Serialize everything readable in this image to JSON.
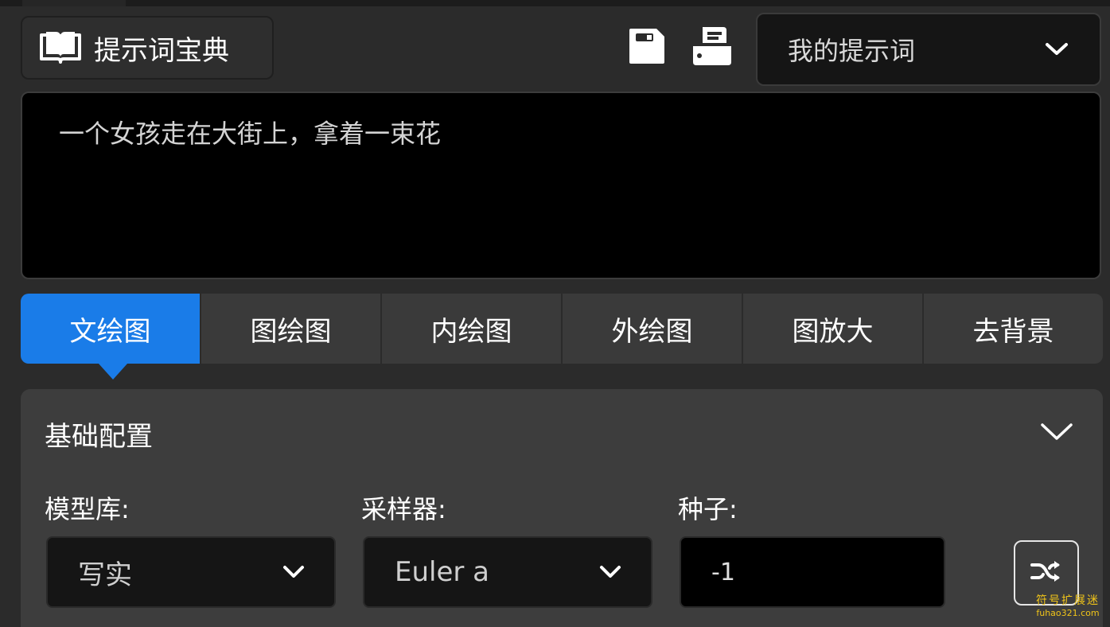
{
  "header": {
    "dict_button_label": "提示词宝典",
    "icons": {
      "dict": "book-icon",
      "save": "floppy-save-icon",
      "load": "load-prompt-icon"
    },
    "prompt_select": {
      "value": "我的提示词",
      "icon": "chevron-down-icon"
    }
  },
  "prompt": {
    "text": "一个女孩走在大街上，拿着一束花"
  },
  "tabs": [
    {
      "label": "文绘图",
      "active": true
    },
    {
      "label": "图绘图",
      "active": false
    },
    {
      "label": "内绘图",
      "active": false
    },
    {
      "label": "外绘图",
      "active": false
    },
    {
      "label": "图放大",
      "active": false
    },
    {
      "label": "去背景",
      "active": false
    }
  ],
  "config": {
    "title": "基础配置",
    "toggle_icon": "chevron-down-icon",
    "model": {
      "label": "模型库:",
      "value": "写实"
    },
    "sampler": {
      "label": "采样器:",
      "value": "Euler a"
    },
    "seed": {
      "label": "种子:",
      "value": "-1"
    },
    "shuffle_icon": "shuffle-icon"
  },
  "watermark": {
    "cn": "符号扩展迷",
    "en": "fuhao321.com"
  },
  "colors": {
    "accent": "#1a7ce8",
    "background": "#2b2b2b",
    "panel": "#3d3d3d",
    "input_bg": "#000000"
  }
}
